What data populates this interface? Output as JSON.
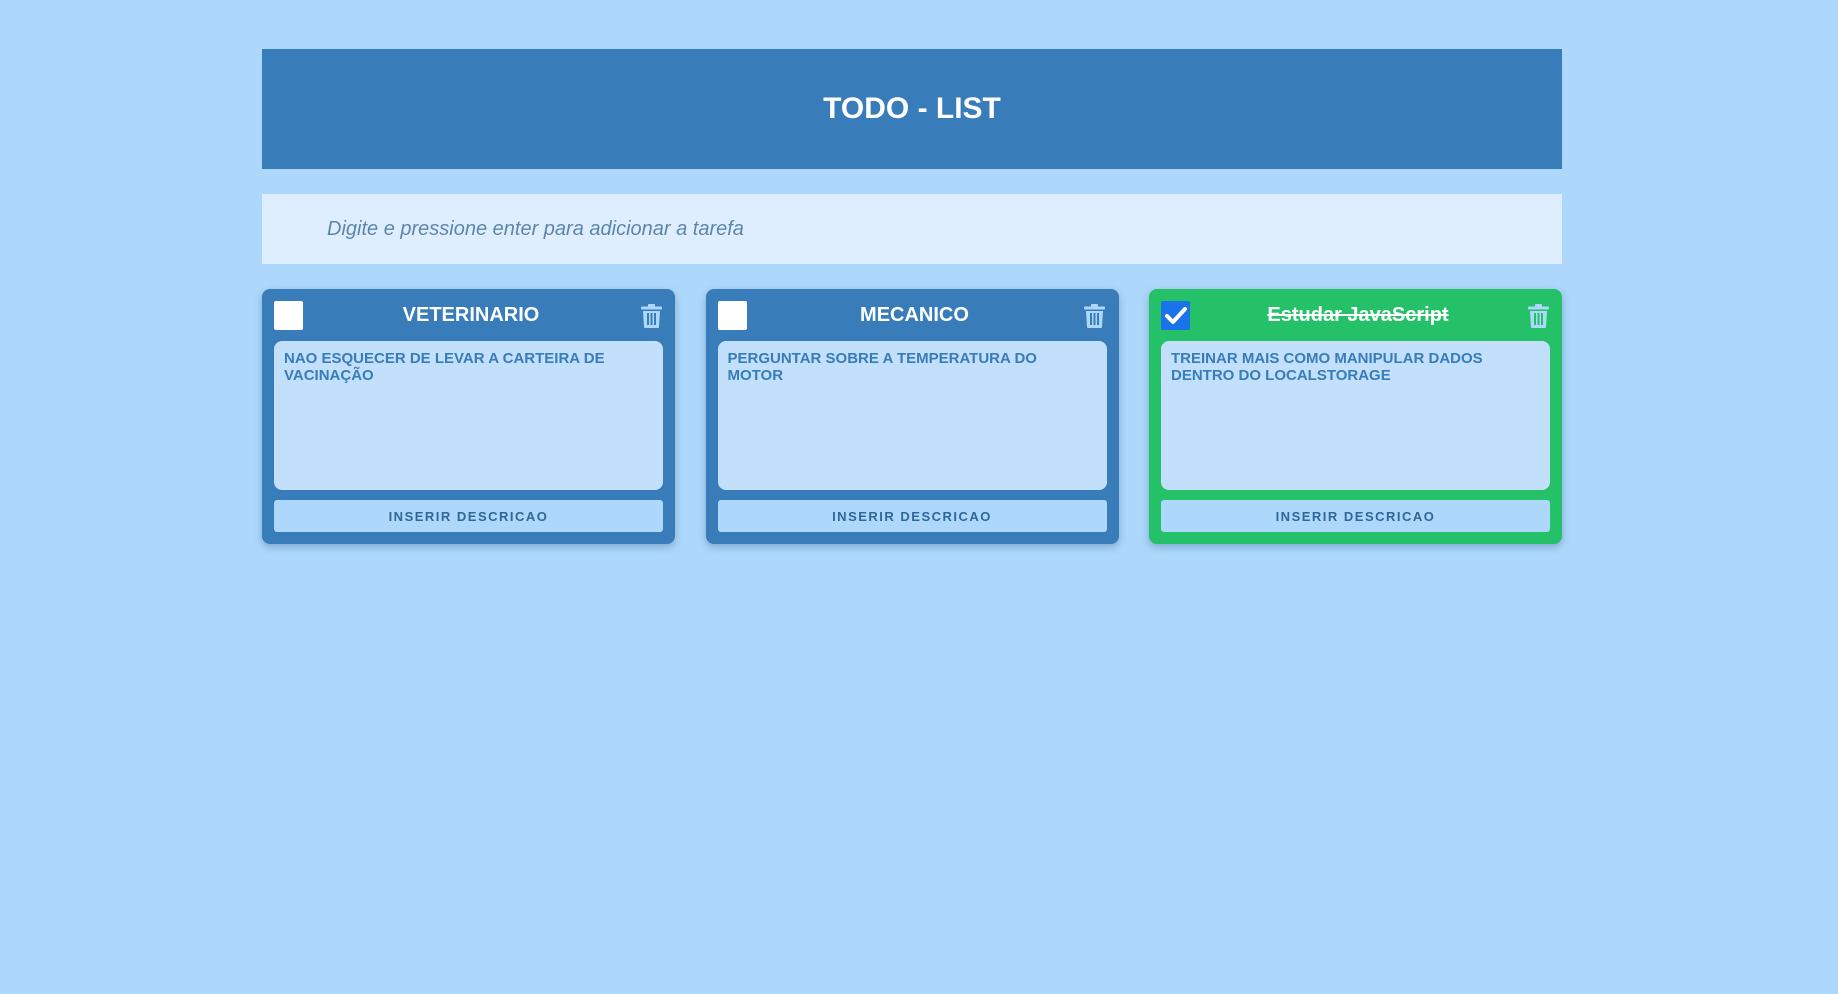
{
  "header": {
    "title": "TODO - LIST"
  },
  "task_input": {
    "placeholder": "Digite e pressione enter para adicionar a tarefa",
    "value": ""
  },
  "colors": {
    "background": "#add8fb",
    "header": "#387cba",
    "card_pending": "#387cba",
    "card_done": "#24c168",
    "description_bg": "#c2e0fc",
    "description_text": "#387cba",
    "checkbox_checked": "#1a73e8"
  },
  "icons": {
    "delete": "trash-icon",
    "checked": "checkmark-icon"
  },
  "cards": [
    {
      "title": "VETERINARIO",
      "checked": false,
      "description": "NAO ESQUECER DE LEVAR A CARTEIRA DE VACINAÇÃO",
      "button_label": "INSERIR DESCRICAO"
    },
    {
      "title": "MECANICO",
      "checked": false,
      "description": "PERGUNTAR SOBRE A TEMPERATURA DO MOTOR",
      "button_label": "INSERIR DESCRICAO"
    },
    {
      "title": "Estudar JavaScript",
      "checked": true,
      "description": "TREINAR MAIS COMO MANIPULAR DADOS DENTRO DO LOCALSTORAGE",
      "button_label": "INSERIR DESCRICAO"
    }
  ]
}
